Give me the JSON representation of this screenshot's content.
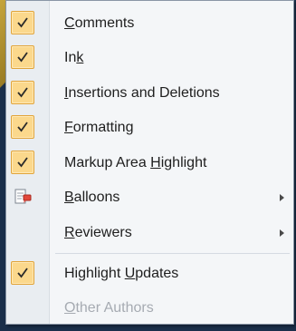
{
  "menu": {
    "items": [
      {
        "label_pre": "",
        "label_key": "C",
        "label_post": "omments",
        "checked": true,
        "icon": "checkmark-icon"
      },
      {
        "label_pre": "In",
        "label_key": "k",
        "label_post": "",
        "checked": true,
        "icon": "checkmark-icon"
      },
      {
        "label_pre": "",
        "label_key": "I",
        "label_post": "nsertions and Deletions",
        "checked": true,
        "icon": "checkmark-icon"
      },
      {
        "label_pre": "",
        "label_key": "F",
        "label_post": "ormatting",
        "checked": true,
        "icon": "checkmark-icon"
      },
      {
        "label_pre": "Markup Area ",
        "label_key": "H",
        "label_post": "ighlight",
        "checked": true,
        "icon": "checkmark-icon"
      },
      {
        "label_pre": "",
        "label_key": "B",
        "label_post": "alloons",
        "checked": false,
        "icon": "balloons-icon",
        "submenu": true
      },
      {
        "label_pre": "",
        "label_key": "R",
        "label_post": "eviewers",
        "checked": false,
        "icon": "",
        "submenu": true
      },
      {
        "label_pre": "Highlight ",
        "label_key": "U",
        "label_post": "pdates",
        "checked": true,
        "icon": "checkmark-icon"
      },
      {
        "label_pre": "",
        "label_key": "O",
        "label_post": "ther Authors",
        "checked": false,
        "icon": "",
        "disabled": true
      }
    ]
  },
  "colors": {
    "check_background": "#fbd88c",
    "check_border": "#e1a43a",
    "disabled_text": "#a6abb2"
  }
}
